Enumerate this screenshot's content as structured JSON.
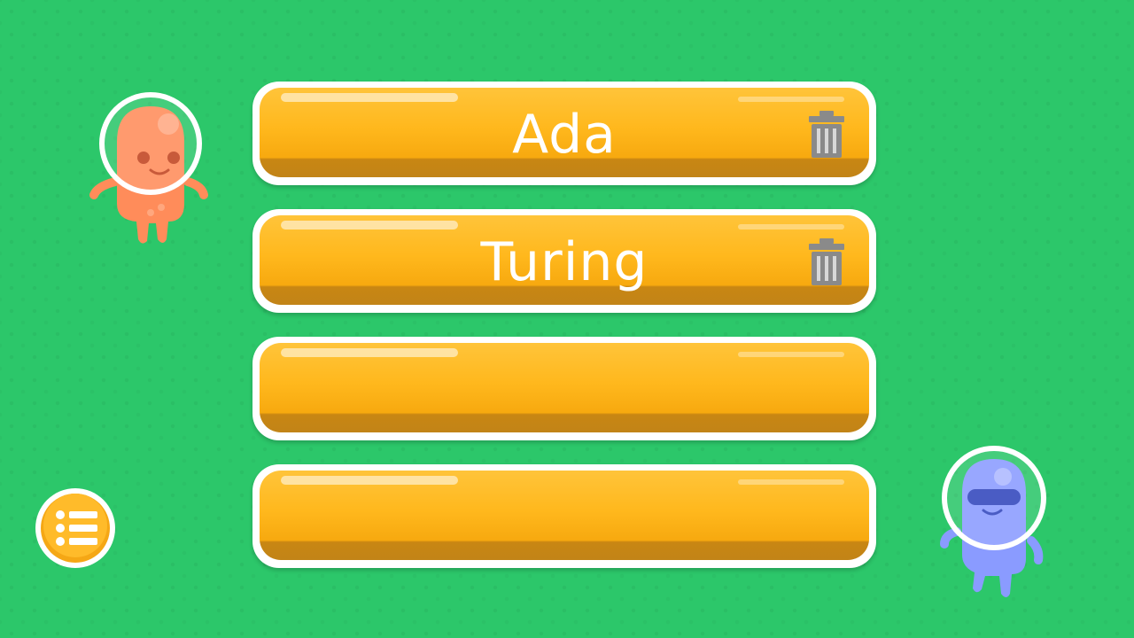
{
  "save_slots": [
    {
      "name": "Ada",
      "has_delete": true
    },
    {
      "name": "Turing",
      "has_delete": true
    },
    {
      "name": "",
      "has_delete": false
    },
    {
      "name": "",
      "has_delete": false
    }
  ],
  "icons": {
    "delete": "trash-icon",
    "menu": "list-menu-icon",
    "avatar_left": "orange-alien-character",
    "avatar_right": "blue-alien-character"
  },
  "colors": {
    "background": "#2cc76a",
    "slot_fill": "#ffb81d",
    "slot_border": "#ffffff",
    "name_text": "#ffffff",
    "trash": "#8a8a8a",
    "orange_alien": "#ff8c5a",
    "blue_alien": "#8a9bff"
  }
}
